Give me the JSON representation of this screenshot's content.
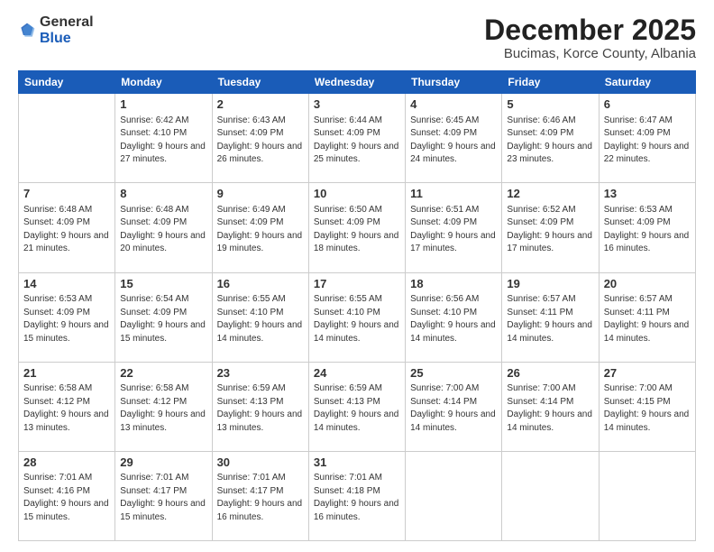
{
  "logo": {
    "general": "General",
    "blue": "Blue"
  },
  "header": {
    "month": "December 2025",
    "location": "Bucimas, Korce County, Albania"
  },
  "days_of_week": [
    "Sunday",
    "Monday",
    "Tuesday",
    "Wednesday",
    "Thursday",
    "Friday",
    "Saturday"
  ],
  "weeks": [
    [
      {
        "day": null
      },
      {
        "day": "1",
        "sunrise": "6:42 AM",
        "sunset": "4:10 PM",
        "daylight": "9 hours and 27 minutes."
      },
      {
        "day": "2",
        "sunrise": "6:43 AM",
        "sunset": "4:09 PM",
        "daylight": "9 hours and 26 minutes."
      },
      {
        "day": "3",
        "sunrise": "6:44 AM",
        "sunset": "4:09 PM",
        "daylight": "9 hours and 25 minutes."
      },
      {
        "day": "4",
        "sunrise": "6:45 AM",
        "sunset": "4:09 PM",
        "daylight": "9 hours and 24 minutes."
      },
      {
        "day": "5",
        "sunrise": "6:46 AM",
        "sunset": "4:09 PM",
        "daylight": "9 hours and 23 minutes."
      },
      {
        "day": "6",
        "sunrise": "6:47 AM",
        "sunset": "4:09 PM",
        "daylight": "9 hours and 22 minutes."
      }
    ],
    [
      {
        "day": "7",
        "sunrise": "6:48 AM",
        "sunset": "4:09 PM",
        "daylight": "9 hours and 21 minutes."
      },
      {
        "day": "8",
        "sunrise": "6:48 AM",
        "sunset": "4:09 PM",
        "daylight": "9 hours and 20 minutes."
      },
      {
        "day": "9",
        "sunrise": "6:49 AM",
        "sunset": "4:09 PM",
        "daylight": "9 hours and 19 minutes."
      },
      {
        "day": "10",
        "sunrise": "6:50 AM",
        "sunset": "4:09 PM",
        "daylight": "9 hours and 18 minutes."
      },
      {
        "day": "11",
        "sunrise": "6:51 AM",
        "sunset": "4:09 PM",
        "daylight": "9 hours and 17 minutes."
      },
      {
        "day": "12",
        "sunrise": "6:52 AM",
        "sunset": "4:09 PM",
        "daylight": "9 hours and 17 minutes."
      },
      {
        "day": "13",
        "sunrise": "6:53 AM",
        "sunset": "4:09 PM",
        "daylight": "9 hours and 16 minutes."
      }
    ],
    [
      {
        "day": "14",
        "sunrise": "6:53 AM",
        "sunset": "4:09 PM",
        "daylight": "9 hours and 15 minutes."
      },
      {
        "day": "15",
        "sunrise": "6:54 AM",
        "sunset": "4:09 PM",
        "daylight": "9 hours and 15 minutes."
      },
      {
        "day": "16",
        "sunrise": "6:55 AM",
        "sunset": "4:10 PM",
        "daylight": "9 hours and 14 minutes."
      },
      {
        "day": "17",
        "sunrise": "6:55 AM",
        "sunset": "4:10 PM",
        "daylight": "9 hours and 14 minutes."
      },
      {
        "day": "18",
        "sunrise": "6:56 AM",
        "sunset": "4:10 PM",
        "daylight": "9 hours and 14 minutes."
      },
      {
        "day": "19",
        "sunrise": "6:57 AM",
        "sunset": "4:11 PM",
        "daylight": "9 hours and 14 minutes."
      },
      {
        "day": "20",
        "sunrise": "6:57 AM",
        "sunset": "4:11 PM",
        "daylight": "9 hours and 14 minutes."
      }
    ],
    [
      {
        "day": "21",
        "sunrise": "6:58 AM",
        "sunset": "4:12 PM",
        "daylight": "9 hours and 13 minutes."
      },
      {
        "day": "22",
        "sunrise": "6:58 AM",
        "sunset": "4:12 PM",
        "daylight": "9 hours and 13 minutes."
      },
      {
        "day": "23",
        "sunrise": "6:59 AM",
        "sunset": "4:13 PM",
        "daylight": "9 hours and 13 minutes."
      },
      {
        "day": "24",
        "sunrise": "6:59 AM",
        "sunset": "4:13 PM",
        "daylight": "9 hours and 14 minutes."
      },
      {
        "day": "25",
        "sunrise": "7:00 AM",
        "sunset": "4:14 PM",
        "daylight": "9 hours and 14 minutes."
      },
      {
        "day": "26",
        "sunrise": "7:00 AM",
        "sunset": "4:14 PM",
        "daylight": "9 hours and 14 minutes."
      },
      {
        "day": "27",
        "sunrise": "7:00 AM",
        "sunset": "4:15 PM",
        "daylight": "9 hours and 14 minutes."
      }
    ],
    [
      {
        "day": "28",
        "sunrise": "7:01 AM",
        "sunset": "4:16 PM",
        "daylight": "9 hours and 15 minutes."
      },
      {
        "day": "29",
        "sunrise": "7:01 AM",
        "sunset": "4:17 PM",
        "daylight": "9 hours and 15 minutes."
      },
      {
        "day": "30",
        "sunrise": "7:01 AM",
        "sunset": "4:17 PM",
        "daylight": "9 hours and 16 minutes."
      },
      {
        "day": "31",
        "sunrise": "7:01 AM",
        "sunset": "4:18 PM",
        "daylight": "9 hours and 16 minutes."
      },
      {
        "day": null
      },
      {
        "day": null
      },
      {
        "day": null
      }
    ]
  ],
  "labels": {
    "sunrise": "Sunrise:",
    "sunset": "Sunset:",
    "daylight": "Daylight:"
  }
}
